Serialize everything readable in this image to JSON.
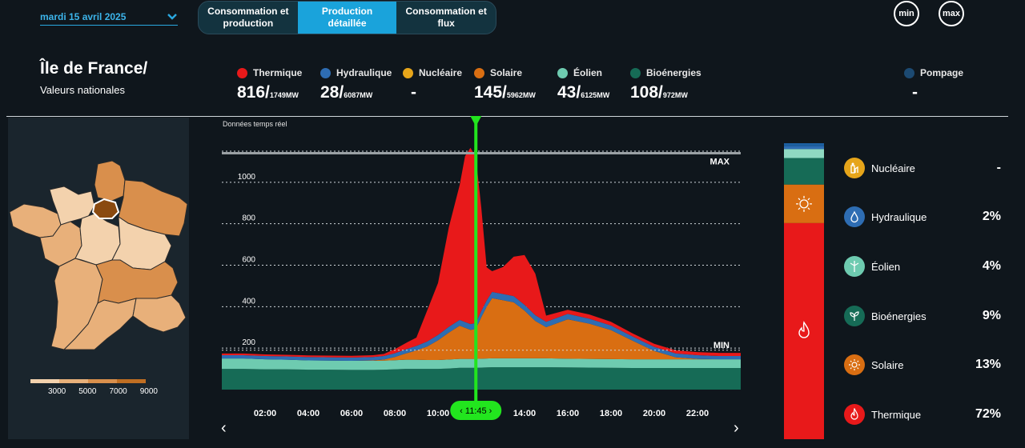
{
  "date": {
    "label": "mardi 15 avril 2025"
  },
  "tabs": [
    {
      "label": "Consommation et production",
      "active": false
    },
    {
      "label": "Production détaillée",
      "active": true
    },
    {
      "label": "Consommation et flux",
      "active": false
    }
  ],
  "buttons": {
    "min": "min",
    "max": "max"
  },
  "region": {
    "title": "Île de France/",
    "subtitle": "Valeurs nationales"
  },
  "sources": [
    {
      "name": "Thermique",
      "value": "816/",
      "max": "1749MW",
      "color": "#e8191a"
    },
    {
      "name": "Hydraulique",
      "value": "28/",
      "max": "6087MW",
      "color": "#2e6db3"
    },
    {
      "name": "Nucléaire",
      "value": "-",
      "max": "",
      "color": "#e6a51a"
    },
    {
      "name": "Solaire",
      "value": "145/",
      "max": "5962MW",
      "color": "#d96e12"
    },
    {
      "name": "Éolien",
      "value": "43/",
      "max": "6125MW",
      "color": "#6ecbb0"
    },
    {
      "name": "Bioénergies",
      "value": "108/",
      "max": "972MW",
      "color": "#166b56"
    },
    {
      "name": "Pompage",
      "value": "-",
      "max": "",
      "color": "#1c4a72"
    }
  ],
  "map_legend": {
    "ticks": [
      "3000",
      "5000",
      "7000",
      "9000"
    ],
    "colors": [
      "#f3d2ad",
      "#e8b07a",
      "#d98f4c",
      "#c06e22"
    ]
  },
  "chart": {
    "realtime_label": "Données temps réel",
    "max_label": "MAX",
    "min_label": "MIN",
    "cursor_time": "11:45"
  },
  "chart_data": {
    "type": "area",
    "title": "Données temps réel",
    "x_tick_labels": [
      "02:00",
      "04:00",
      "06:00",
      "08:00",
      "10:00",
      "12:00",
      "14:00",
      "16:00",
      "18:00",
      "20:00",
      "22:00"
    ],
    "y_tick_labels": [
      "200",
      "400",
      "600",
      "800",
      "1000"
    ],
    "ylim": [
      0,
      1200
    ],
    "xlim": [
      0,
      24
    ],
    "max_line": 1140,
    "min_line": 190,
    "x": [
      0,
      1,
      2,
      3,
      4,
      5,
      6,
      7,
      7.5,
      8,
      8.5,
      9,
      9.5,
      10,
      10.5,
      11,
      11.25,
      11.5,
      11.75,
      12,
      12.25,
      12.5,
      13,
      13.5,
      14,
      14.5,
      15,
      16,
      17,
      18,
      19,
      20,
      21,
      22,
      23,
      24
    ],
    "series": [
      {
        "name": "Bioénergies",
        "color": "#166b56",
        "values": [
          100,
          100,
          98,
          98,
          96,
          96,
          95,
          95,
          96,
          98,
          100,
          100,
          100,
          100,
          102,
          105,
          105,
          105,
          105,
          106,
          107,
          108,
          108,
          108,
          108,
          108,
          108,
          107,
          106,
          105,
          104,
          104,
          104,
          104,
          104,
          104
        ]
      },
      {
        "name": "Éolien",
        "color": "#6ecbb0",
        "values": [
          50,
          50,
          48,
          46,
          45,
          44,
          44,
          44,
          44,
          44,
          44,
          44,
          43,
          43,
          43,
          43,
          43,
          43,
          43,
          43,
          43,
          43,
          43,
          43,
          43,
          43,
          43,
          42,
          42,
          42,
          42,
          42,
          42,
          42,
          42,
          42
        ]
      },
      {
        "name": "Solaire",
        "color": "#d96e12",
        "values": [
          0,
          0,
          0,
          0,
          0,
          0,
          0,
          2,
          5,
          15,
          30,
          45,
          65,
          95,
          130,
          160,
          150,
          140,
          145,
          200,
          250,
          290,
          280,
          270,
          230,
          180,
          150,
          190,
          170,
          140,
          90,
          40,
          10,
          2,
          0,
          0
        ]
      },
      {
        "name": "Hydraulique",
        "color": "#2e6db3",
        "values": [
          16,
          16,
          16,
          16,
          16,
          16,
          16,
          16,
          17,
          18,
          20,
          22,
          24,
          26,
          28,
          28,
          28,
          28,
          28,
          30,
          30,
          30,
          30,
          30,
          28,
          28,
          26,
          26,
          24,
          22,
          20,
          20,
          18,
          18,
          16,
          16
        ]
      },
      {
        "name": "Thermique",
        "color": "#e8191a",
        "values": [
          8,
          8,
          8,
          8,
          8,
          8,
          8,
          9,
          10,
          20,
          30,
          40,
          150,
          250,
          480,
          650,
          800,
          850,
          800,
          500,
          160,
          100,
          130,
          190,
          240,
          200,
          30,
          20,
          20,
          18,
          15,
          15,
          15,
          15,
          15,
          15
        ]
      }
    ]
  },
  "mix_bar": [
    {
      "name": "Pompage",
      "value": 1,
      "color": "#1c5fa0"
    },
    {
      "name": "Hydraulique",
      "value": 1,
      "color": "#2e6db3"
    },
    {
      "name": "Éolien",
      "value": 3,
      "color": "#8fd9c2"
    },
    {
      "name": "Bioénergies",
      "value": 9,
      "color": "#166b56"
    },
    {
      "name": "Solaire",
      "value": 13,
      "color": "#d96e12"
    },
    {
      "name": "Thermique",
      "value": 73,
      "color": "#e8191a"
    }
  ],
  "mix_list": [
    {
      "name": "Nucléaire",
      "pct": "-",
      "color": "#e6a51a",
      "icon": "nuclear-icon"
    },
    {
      "name": "Hydraulique",
      "pct": "2%",
      "color": "#2e6db3",
      "icon": "water-drop-icon"
    },
    {
      "name": "Éolien",
      "pct": "4%",
      "color": "#6ecbb0",
      "icon": "wind-turbine-icon"
    },
    {
      "name": "Bioénergies",
      "pct": "9%",
      "color": "#166b56",
      "icon": "leaf-icon"
    },
    {
      "name": "Solaire",
      "pct": "13%",
      "color": "#d96e12",
      "icon": "sun-icon"
    },
    {
      "name": "Thermique",
      "pct": "72%",
      "color": "#e8191a",
      "icon": "flame-icon"
    }
  ]
}
